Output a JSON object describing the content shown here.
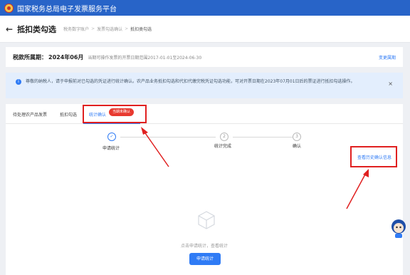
{
  "app": {
    "title": "国家税务总局电子发票服务平台"
  },
  "header": {
    "back_icon": "arrow-left-icon",
    "page_title": "抵扣类勾选",
    "breadcrumb": [
      "税务数字账户",
      "发票勾选确认",
      "抵扣类勾选"
    ]
  },
  "period": {
    "label": "税款所属期：",
    "value": "2024年06月",
    "hint": "当期可操作发票的开票日期范围2017-01-01至2024-06-30",
    "switch_label": "变更属期"
  },
  "notice": {
    "text": "尊敬的纳税人，请于申报前对已勾选的凭证进行统计确认。农产品业务抵扣勾选和代扣代缴完税凭证勾选功能，可对开票日期在2023年07月01日后的票证进行抵扣勾选操作。",
    "close": "×"
  },
  "tabs": [
    {
      "label": "待处理农产品发票",
      "active": false
    },
    {
      "label": "抵扣勾选",
      "active": false
    },
    {
      "label": "统计确认",
      "active": true
    }
  ],
  "tab_badge": "当期未确认",
  "steps": [
    {
      "number": "✓",
      "label": "申请统计",
      "status": "done"
    },
    {
      "number": "2",
      "label": "统计完成",
      "status": "pending"
    },
    {
      "number": "3",
      "label": "确认",
      "status": "pending"
    }
  ],
  "history_link": "查看历史确认信息",
  "empty": {
    "icon": "box-icon",
    "text": "点击申请统计，查看统计"
  },
  "apply_button": "申请统计",
  "colors": {
    "brand": "#2864c8",
    "accent": "#2f7bf5",
    "highlight": "#e02020",
    "badge": "#e8392f"
  }
}
